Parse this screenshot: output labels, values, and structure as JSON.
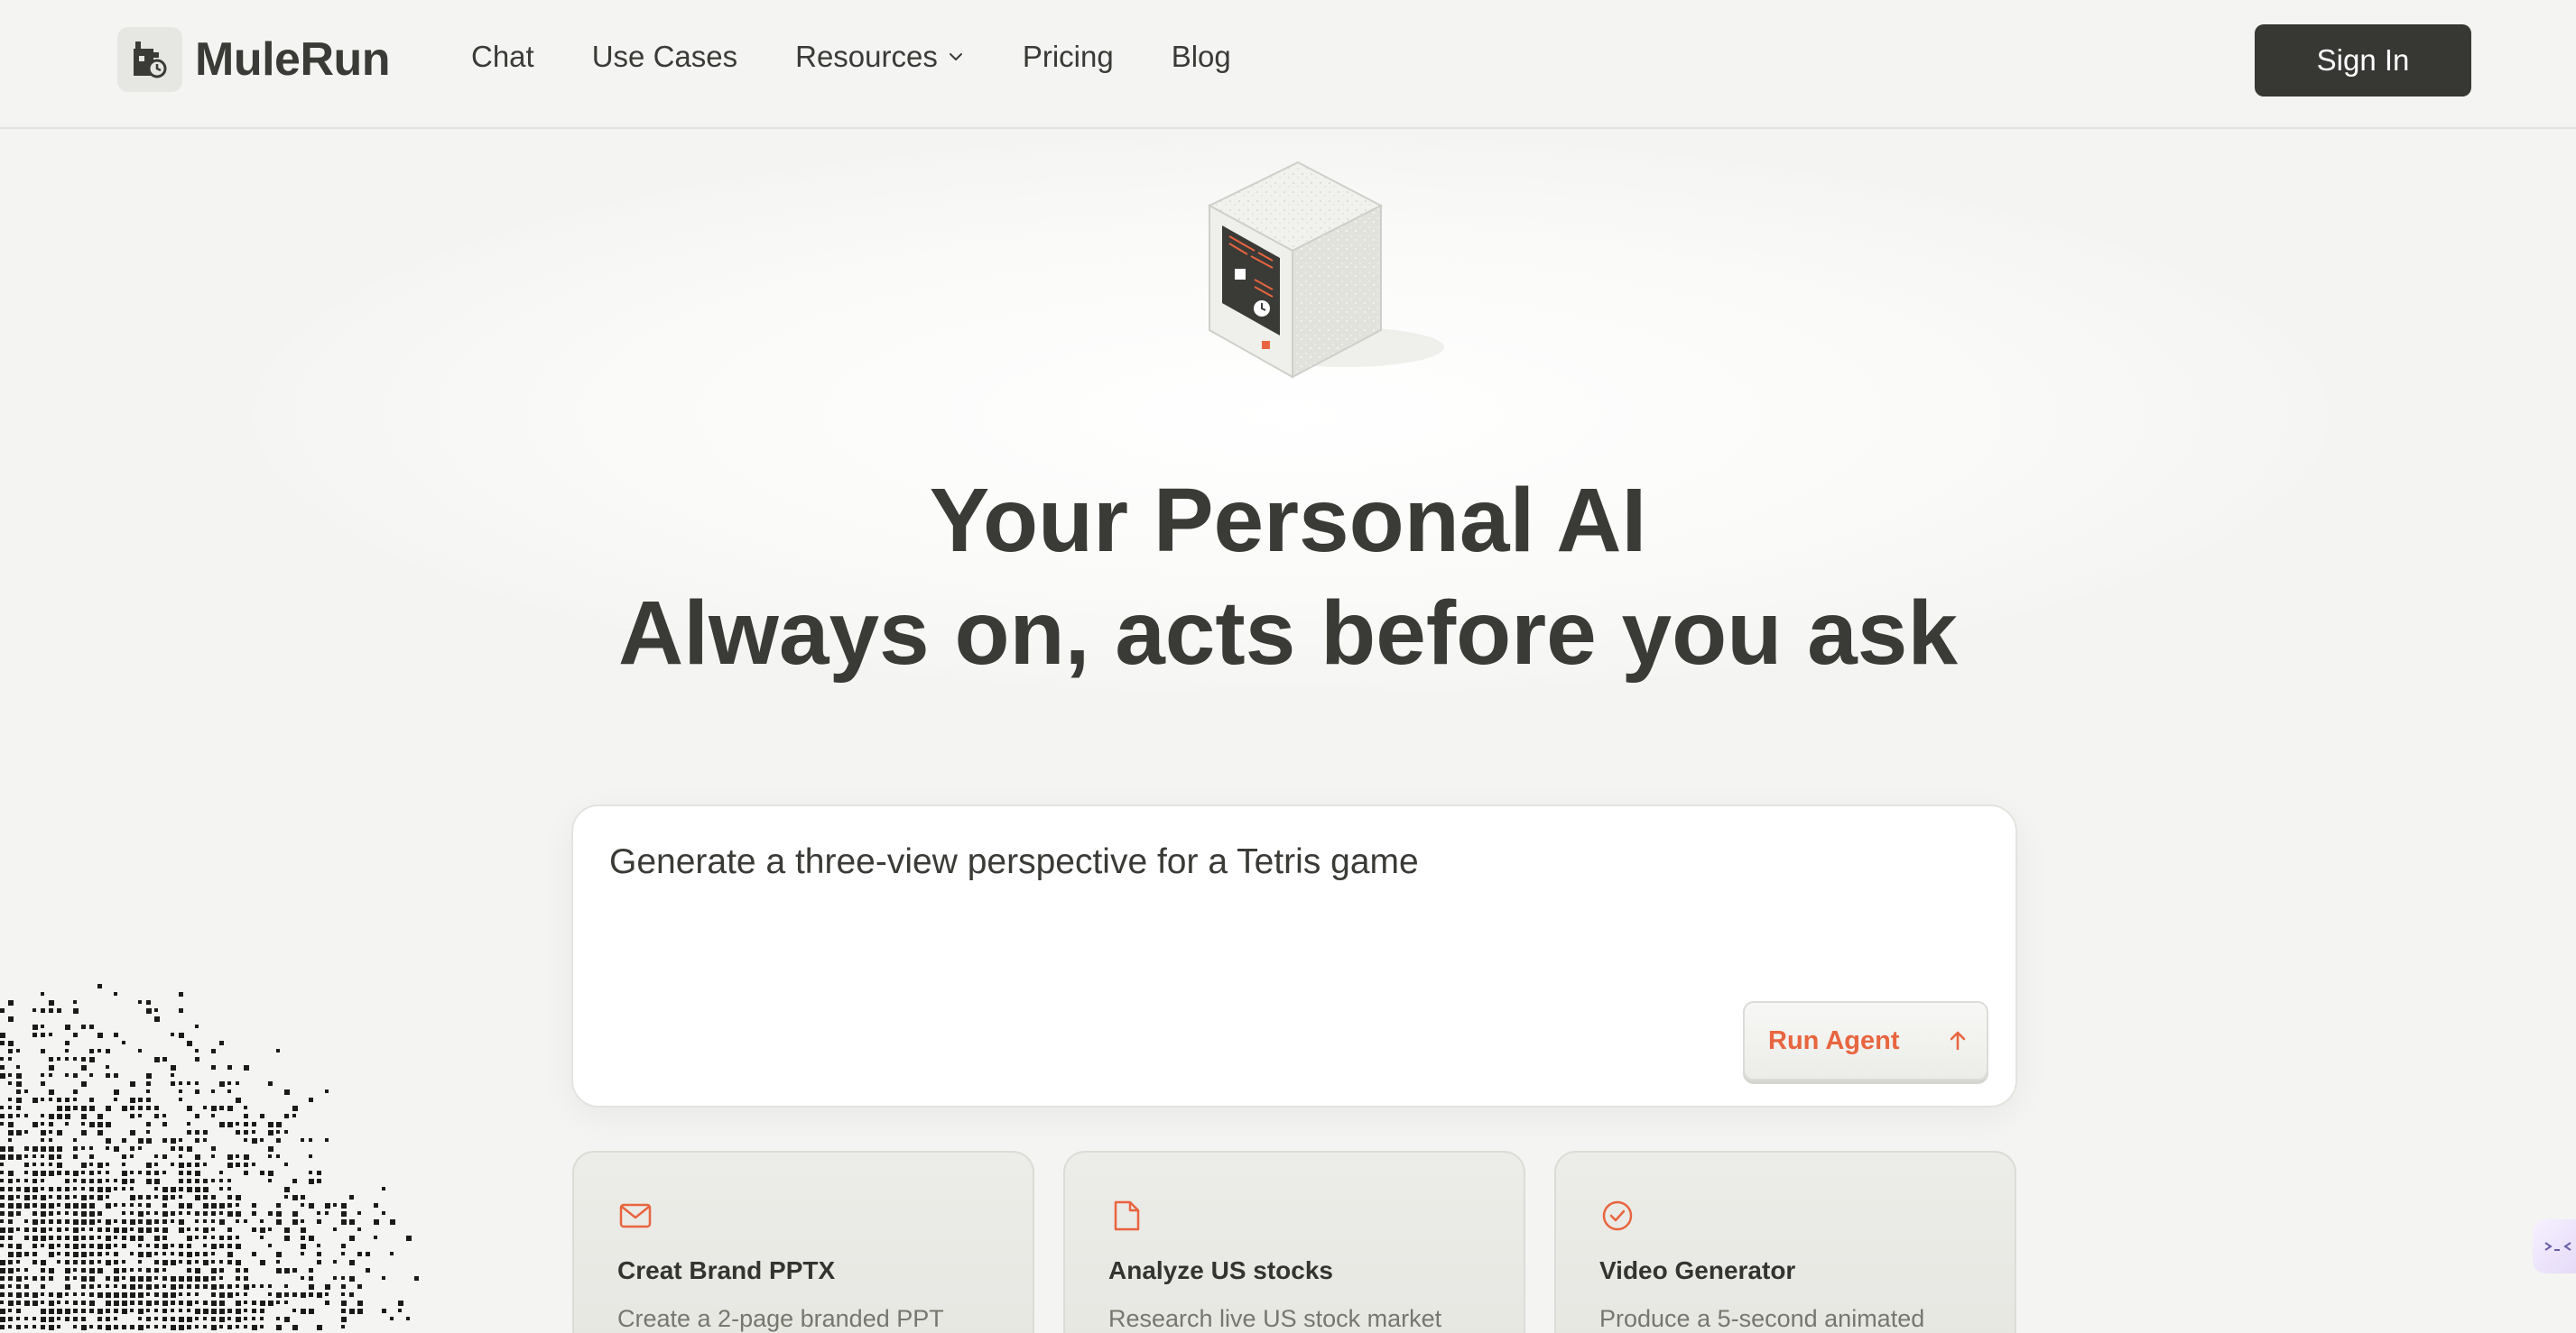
{
  "brand": {
    "name": "MuleRun"
  },
  "nav": {
    "items": [
      {
        "label": "Chat"
      },
      {
        "label": "Use Cases"
      },
      {
        "label": "Resources",
        "has_dropdown": true
      },
      {
        "label": "Pricing"
      },
      {
        "label": "Blog"
      }
    ],
    "signin_label": "Sign In"
  },
  "hero": {
    "line1": "Your Personal AI",
    "line2": "Always on, acts before you ask"
  },
  "prompt": {
    "text": "Generate a three-view perspective for a Tetris game",
    "run_label": "Run Agent"
  },
  "cards": [
    {
      "icon": "mail-icon",
      "title": "Creat Brand PPTX",
      "desc": "Create a 2-page branded PPT"
    },
    {
      "icon": "document-icon",
      "title": "Analyze US stocks",
      "desc": "Research live US stock market"
    },
    {
      "icon": "check-circle-icon",
      "title": "Video Generator",
      "desc": "Produce a 5-second animated"
    }
  ],
  "colors": {
    "accent": "#e8653f",
    "dark_button": "#373834",
    "background": "#f4f4f2"
  }
}
